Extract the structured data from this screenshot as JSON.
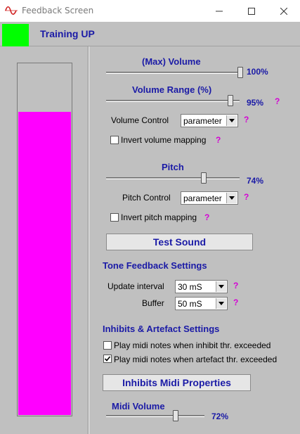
{
  "window": {
    "title": "Feedback Screen",
    "icon": "waveform-icon"
  },
  "header": {
    "status_text": "Training UP",
    "status_color": "#00ff00"
  },
  "level_meter": {
    "level": 0.86,
    "fill_color": "#ff00ff"
  },
  "volume": {
    "label": "(Max) Volume",
    "value_text": "100%",
    "value": 1.0
  },
  "volume_range": {
    "label": "Volume Range (%)",
    "value_text": "95%",
    "value": 0.95,
    "help": "?"
  },
  "volume_control": {
    "label": "Volume Control",
    "selected": "parameter",
    "help": "?"
  },
  "invert_volume": {
    "label": "Invert volume mapping",
    "checked": false,
    "help": "?"
  },
  "pitch": {
    "label": "Pitch",
    "value_text": "74%",
    "value": 0.74
  },
  "pitch_control": {
    "label": "Pitch Control",
    "selected": "parameter",
    "help": "?"
  },
  "invert_pitch": {
    "label": "Invert pitch mapping",
    "checked": false,
    "help": "?"
  },
  "test_sound": {
    "label": "Test Sound"
  },
  "tone_feedback": {
    "heading": "Tone Feedback Settings",
    "update_interval": {
      "label": "Update interval",
      "selected": "30 mS",
      "help": "?"
    },
    "buffer": {
      "label": "Buffer",
      "selected": "50 mS",
      "help": "?"
    }
  },
  "inhibits": {
    "heading": "Inhibits & Artefact Settings",
    "inhibit_midi": {
      "label": "Play midi notes when inhibit thr. exceeded",
      "checked": false
    },
    "artefact_midi": {
      "label": "Play midi notes when artefact thr. exceeded",
      "checked": true
    },
    "properties_button": "Inhibits Midi Properties"
  },
  "midi_volume": {
    "label": "Midi Volume",
    "value_text": "72%",
    "value": 0.72
  }
}
